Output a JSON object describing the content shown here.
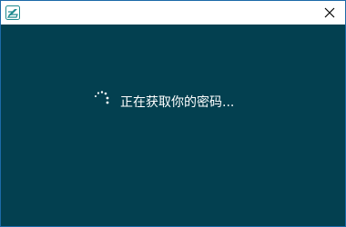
{
  "window": {
    "app_icon": "app-logo-icon",
    "close_icon": "close-icon"
  },
  "content": {
    "spinner_icon": "loading-spinner-icon",
    "status_text": "正在获取你的密码..."
  },
  "colors": {
    "content_background": "#034050",
    "window_border": "#1c6aa8",
    "text": "#ffffff",
    "app_icon": "#1e8a8f"
  }
}
